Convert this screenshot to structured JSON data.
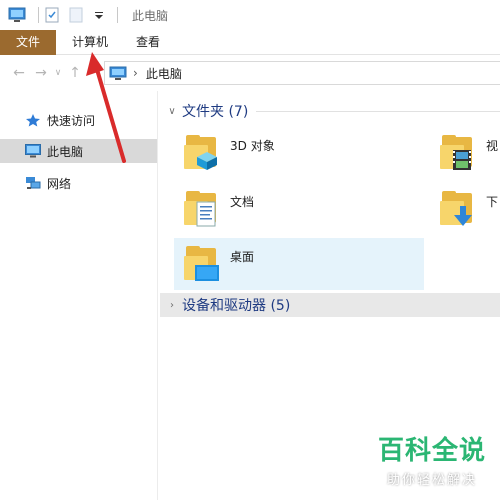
{
  "titlebar": {
    "title": "此电脑",
    "quick_access_icons": [
      "computer-icon",
      "properties-icon",
      "new-folder-icon",
      "customize-dropdown-icon"
    ]
  },
  "ribbon": {
    "tabs": [
      {
        "label": "文件",
        "active": true
      },
      {
        "label": "计算机"
      },
      {
        "label": "查看"
      }
    ]
  },
  "address": {
    "location": "此电脑",
    "separator": "›"
  },
  "navpane": {
    "items": [
      {
        "label": "快速访问",
        "icon": "star-icon"
      },
      {
        "label": "此电脑",
        "icon": "computer-icon",
        "selected": true
      },
      {
        "label": "网络",
        "icon": "network-icon"
      }
    ]
  },
  "content": {
    "folders_group": {
      "label": "文件夹 (7)",
      "expanded": true
    },
    "folders": [
      {
        "label": "3D 对象",
        "icon": "3d-objects-icon"
      },
      {
        "label": "视",
        "icon": "videos-icon"
      },
      {
        "label": "文档",
        "icon": "documents-icon"
      },
      {
        "label": "下",
        "icon": "downloads-icon"
      },
      {
        "label": "桌面",
        "icon": "desktop-icon",
        "selected": true
      }
    ],
    "devices_group": {
      "label": "设备和驱动器 (5)",
      "expanded": false
    }
  },
  "watermark": {
    "main": "百科全说",
    "sub": "助你轻松解决"
  },
  "colors": {
    "file_tab": "#9b6a2f",
    "selected_tile": "#e5f3fb",
    "group_header": "#1f3b82",
    "arrow": "#d92b2b",
    "watermark": "#2bb673"
  }
}
